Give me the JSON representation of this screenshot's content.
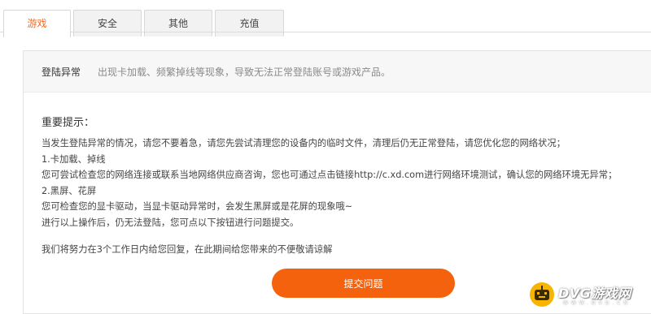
{
  "tabs": [
    {
      "label": "游戏",
      "active": true
    },
    {
      "label": "安全",
      "active": false
    },
    {
      "label": "其他",
      "active": false
    },
    {
      "label": "充值",
      "active": false
    }
  ],
  "category": {
    "name": "登陆异常",
    "description": "出现卡加载、频繁掉线等现象，导致无法正常登陆账号或游戏产品。"
  },
  "content": {
    "heading": "重要提示：",
    "lines": [
      "当发生登陆异常的情况，请您不要着急，请您先尝试清理您的设备内的临时文件，清理后仍无正常登陆，请您优化您的网络状况；",
      "1.卡加载、掉线",
      "您可尝试检查您的网络连接或联系当地网络供应商咨询，您也可通过点击链接http://c.xd.com进行网络环境测试，确认您的网络环境无异常；",
      "2.黑屏、花屏",
      "您可检查您的显卡驱动，当显卡驱动异常时，会发生黑屏或是花屏的现象哦~",
      "进行以上操作后，仍无法登陆，您可点以下按钮进行问题提交。"
    ],
    "note": "我们将努力在3个工作日内给您回复，在此期间给您带来的不便敬请谅解"
  },
  "submit_label": "提交问题",
  "watermark": {
    "text": "DVG游戏网",
    "subtext": "WWW.DVG.CN",
    "icon": "gamepad-robot-icon"
  },
  "colors": {
    "accent": "#f5620d",
    "active_tab_text": "#f26a1f",
    "watermark_icon": "#f7b500"
  }
}
